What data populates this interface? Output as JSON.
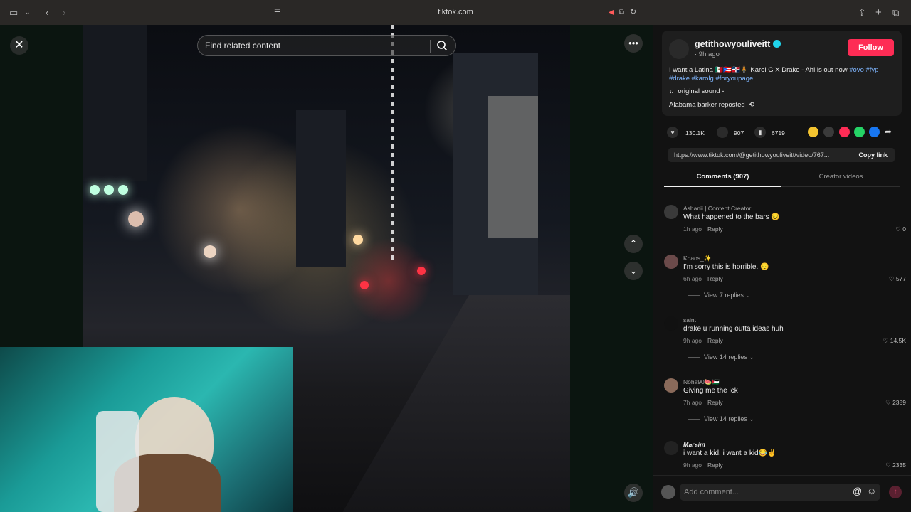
{
  "browser": {
    "url": "tiktok.com"
  },
  "video": {
    "search_placeholder": "Find related content"
  },
  "author": {
    "username": "getithowyouliveitt",
    "time": "· 9h ago",
    "follow_label": "Follow",
    "description": "I want a Latina 🇲🇽🇵🇷🇩🇴🧍 Karol G X Drake - Ahi is out now",
    "hashtags": "#ovo #fyp #drake #karolg #foryoupage",
    "sound": "original sound -",
    "repost": "Alabama barker reposted"
  },
  "stats": {
    "likes": "130.1K",
    "comments": "907",
    "saves": "6719"
  },
  "share": {
    "link": "https://www.tiktok.com/@getithowyouliveitt/video/767...",
    "copy_label": "Copy link"
  },
  "tabs": {
    "comments": "Comments (907)",
    "creator": "Creator videos"
  },
  "comments": [
    {
      "name": "Ashanii | Content Creator",
      "text": "What happened to the bars 😔",
      "time": "1h ago",
      "reply": "Reply",
      "likes": "0",
      "view": ""
    },
    {
      "name": "Khaos_✨",
      "text": "I'm sorry this is horrible. 😔",
      "time": "6h ago",
      "reply": "Reply",
      "likes": "577",
      "view": "View 7 replies"
    },
    {
      "name": "saint",
      "text": "drake u running outta ideas huh",
      "time": "9h ago",
      "reply": "Reply",
      "likes": "14.5K",
      "view": "View 14 replies"
    },
    {
      "name": "Noha90🍉🇵🇸",
      "text": "Giving me the ick",
      "time": "7h ago",
      "reply": "Reply",
      "likes": "2389",
      "view": "View 14 replies"
    },
    {
      "name": "𝑴𝒂𝒓𝒔𝒊𝒎",
      "text": "i want a kid, i want a kid😂✌️",
      "time": "9h ago",
      "reply": "Reply",
      "likes": "2335",
      "view": ""
    }
  ],
  "compose": {
    "placeholder": "Add comment..."
  },
  "colors": {
    "accent": "#fe2c55",
    "link": "#7fb6ff"
  }
}
